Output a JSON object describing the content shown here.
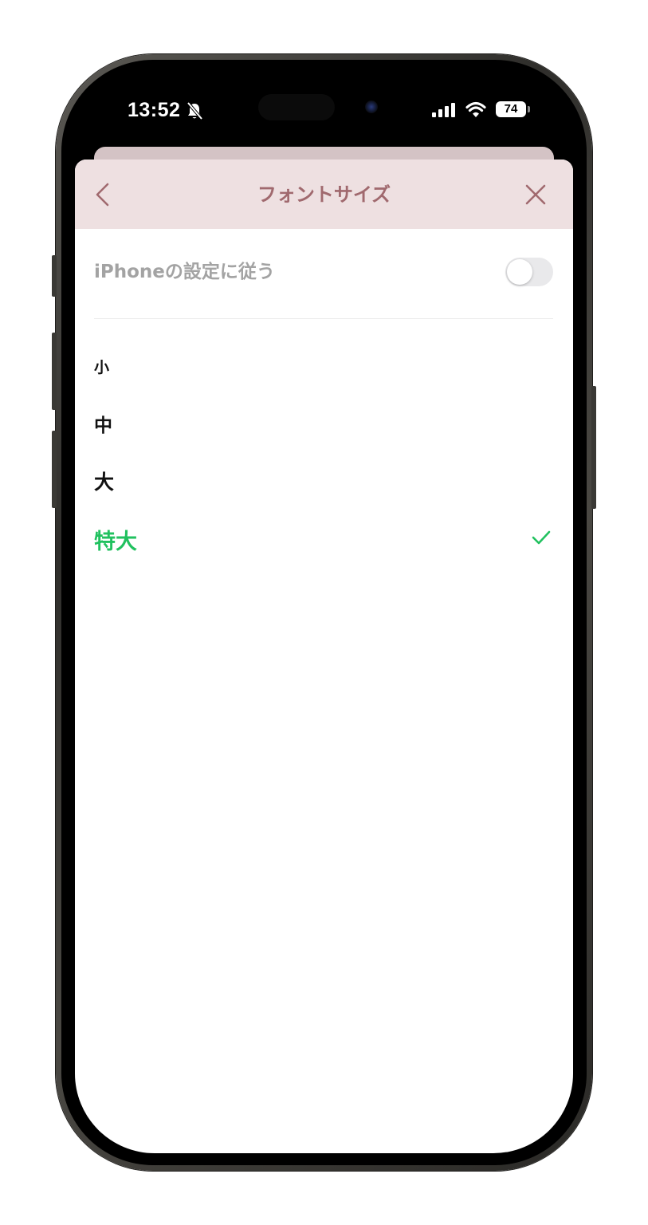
{
  "status_bar": {
    "time": "13:52",
    "battery": "74",
    "silent_icon": "bell-slash-icon",
    "signal_icon": "cellular-signal-icon",
    "wifi_icon": "wifi-icon"
  },
  "header": {
    "title": "フォントサイズ",
    "back_icon": "chevron-left-icon",
    "close_icon": "close-icon"
  },
  "follow_setting": {
    "label": "iPhoneの設定に従う",
    "enabled": false
  },
  "options": [
    {
      "label": "小",
      "selected": false
    },
    {
      "label": "中",
      "selected": false
    },
    {
      "label": "大",
      "selected": false
    },
    {
      "label": "特大",
      "selected": true
    }
  ],
  "colors": {
    "header_bg": "#eee0e1",
    "header_text": "#a0696e",
    "accent_green": "#21c15f",
    "muted_text": "#a3a3a3"
  }
}
